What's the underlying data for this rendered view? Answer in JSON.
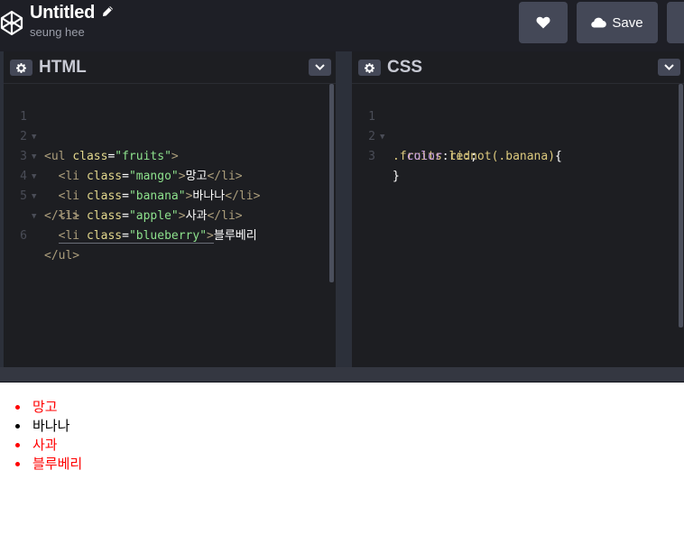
{
  "header": {
    "title": "Untitled",
    "author": "seung hee",
    "save_label": "Save"
  },
  "html_pane": {
    "title": "HTML",
    "line_numbers": [
      "1",
      "2",
      "3",
      "4",
      "5",
      "6"
    ],
    "lines": {
      "l1": {
        "open": "<ul ",
        "attr": "class",
        "eq": "=",
        "str": "\"fruits\"",
        "close": ">"
      },
      "l2": {
        "open": "<li ",
        "attr": "class",
        "eq": "=",
        "str": "\"mango\"",
        "close": ">",
        "text": "망고",
        "end": "</li>"
      },
      "l3": {
        "open": "<li ",
        "attr": "class",
        "eq": "=",
        "str": "\"banana\"",
        "close": ">",
        "text": "바나나",
        "end": "</li>"
      },
      "l4": {
        "open": "<li ",
        "attr": "class",
        "eq": "=",
        "str": "\"apple\"",
        "close": ">",
        "text": "사과",
        "end": "</li>"
      },
      "l5": {
        "open": "<li ",
        "attr": "class",
        "eq": "=",
        "str": "\"blueberry\"",
        "close": ">",
        "text": "블루베리"
      },
      "l5b": {
        "end": "</li>"
      },
      "l6": {
        "end": "</ul>"
      }
    }
  },
  "css_pane": {
    "title": "CSS",
    "line_numbers": [
      "1",
      "2",
      "3"
    ],
    "lines": {
      "l1": {
        "sel": ".fruits li",
        "pseudo": ":not(.banana)",
        "brace": "{"
      },
      "l2": {
        "prop": "color",
        "colon": ":",
        "val": "red",
        "semi": ";"
      },
      "l3": {
        "brace": "}"
      }
    }
  },
  "result": {
    "items": [
      {
        "text": "망고",
        "color": "#ff0000"
      },
      {
        "text": "바나나",
        "color": "#000000"
      },
      {
        "text": "사과",
        "color": "#ff0000"
      },
      {
        "text": "블루베리",
        "color": "#ff0000"
      }
    ]
  },
  "colors": {
    "header_bg": "#1e1f26",
    "pane_bg": "#1d1e22",
    "button_bg": "#444857",
    "accent_red": "#ff0000"
  },
  "icons": [
    "codepen-logo-icon",
    "pencil-icon",
    "heart-icon",
    "cloud-icon",
    "gear-icon",
    "chevron-down-icon",
    "fold-arrow-icon"
  ]
}
